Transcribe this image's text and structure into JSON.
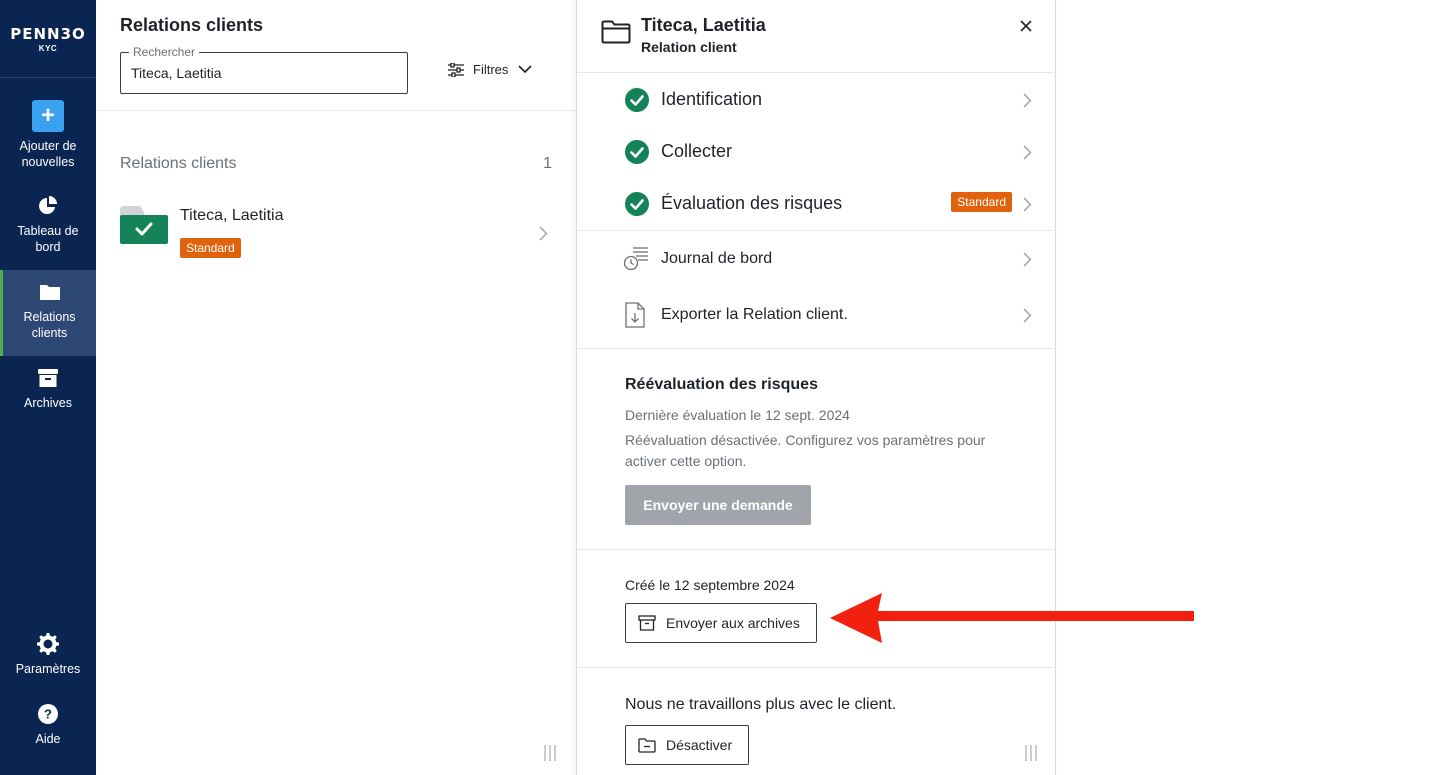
{
  "sidebar": {
    "brand": "PENN3O",
    "brand_sub": "KYC",
    "items": [
      {
        "label": "Ajouter de\nnouvelles",
        "icon": "plus-icon"
      },
      {
        "label": "Tableau de\nbord",
        "icon": "pie-chart-icon"
      },
      {
        "label": "Relations\nclients",
        "icon": "folder-icon",
        "active": true
      },
      {
        "label": "Archives",
        "icon": "archive-icon"
      },
      {
        "label": "Paramètres",
        "icon": "gear-icon"
      },
      {
        "label": "Aide",
        "icon": "help-icon"
      }
    ]
  },
  "list": {
    "title": "Relations clients",
    "search": {
      "legend": "Rechercher",
      "value": "Titeca, Laetitia"
    },
    "filters_label": "Filtres",
    "section_label": "Relations clients",
    "count": "1",
    "client": {
      "name": "Titeca, Laetitia",
      "badge": "Standard"
    }
  },
  "detail": {
    "title": "Titeca, Laetitia",
    "subtitle": "Relation client",
    "steps": [
      {
        "label": "Identification"
      },
      {
        "label": "Collecter"
      },
      {
        "label": "Évaluation des risques",
        "badge": "Standard"
      }
    ],
    "actions": [
      {
        "label": "Journal de bord",
        "icon": "log-clock-icon"
      },
      {
        "label": "Exporter la Relation client.",
        "icon": "export-file-icon"
      }
    ],
    "reevaluation": {
      "title": "Réévaluation des risques",
      "last": "Dernière évaluation le 12 sept. 2024",
      "description": "Réévaluation désactivée. Configurez vos paramètres pour activer cette option.",
      "button": "Envoyer une demande"
    },
    "created": "Créé le 12 septembre 2024",
    "archive_button": "Envoyer aux archives",
    "no_work": "Nous ne travaillons plus avec le client.",
    "deactivate_button": "Désactiver"
  },
  "colors": {
    "sidebar": "#0b2552",
    "accent_green": "#14835a",
    "badge_orange": "#e0620d",
    "add_blue": "#3aa0f0",
    "annotation_red": "#f2200f"
  }
}
